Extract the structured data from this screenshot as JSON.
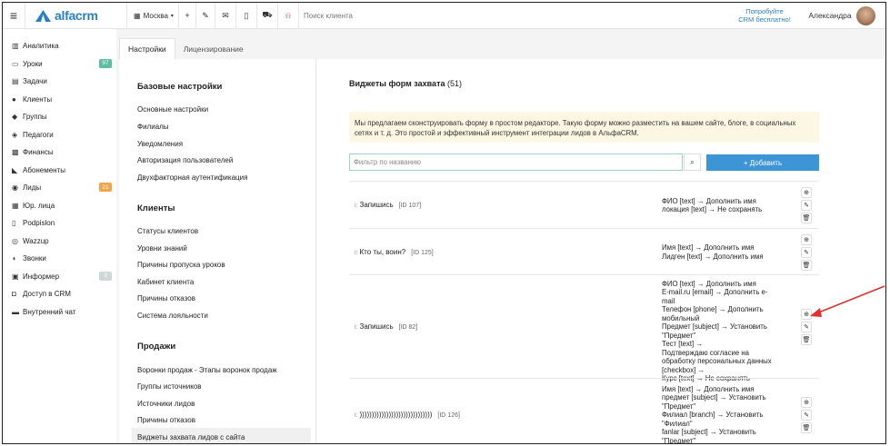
{
  "app": {
    "logo_text": "alfacrm",
    "brand_color": "#2a7fc4"
  },
  "topbar": {
    "city": "Москва",
    "search_placeholder": "Поиск клиента",
    "promo_line1": "Попробуйте",
    "promo_line2": "CRM бесплатно!",
    "user_name": "Александра"
  },
  "sidebar": {
    "items": [
      {
        "label": "Аналитика",
        "icon": "analytics-icon"
      },
      {
        "label": "Уроки",
        "icon": "calendar-icon",
        "badge": "97",
        "badge_color": "#5bbf9f"
      },
      {
        "label": "Задачи",
        "icon": "tasks-icon"
      },
      {
        "label": "Клиенты",
        "icon": "client-icon"
      },
      {
        "label": "Группы",
        "icon": "groups-icon"
      },
      {
        "label": "Педагоги",
        "icon": "teacher-icon"
      },
      {
        "label": "Финансы",
        "icon": "finance-icon"
      },
      {
        "label": "Абонементы",
        "icon": "tag-icon"
      },
      {
        "label": "Лиды",
        "icon": "leads-icon",
        "badge": "21",
        "badge_color": "#f0a54a"
      },
      {
        "label": "Юр. лица",
        "icon": "legal-icon"
      },
      {
        "label": "Podpislon",
        "icon": "document-icon"
      },
      {
        "label": "Wazzup",
        "icon": "whatsapp-icon"
      },
      {
        "label": "Звонки",
        "icon": "phone-icon"
      },
      {
        "label": "Информер",
        "icon": "informer-icon",
        "badge": "3",
        "badge_color": "#cfd6d6"
      },
      {
        "label": "Доступ в CRM",
        "icon": "lock-icon"
      },
      {
        "label": "Внутренний чат",
        "icon": "chat-icon"
      }
    ]
  },
  "tabs": [
    {
      "label": "Настройки"
    },
    {
      "label": "Лицензирование"
    }
  ],
  "settings_menu": {
    "base_title": "Базовые настройки",
    "base_items": [
      "Основные настройки",
      "Филиалы",
      "Уведомления",
      "Авторизация пользователей",
      "Двухфакторная аутентификация"
    ],
    "clients_title": "Клиенты",
    "clients_items": [
      "Статусы клиентов",
      "Уровни знаний",
      "Причины пропуска уроков",
      "Кабинет клиента",
      "Причины отказов",
      "Система лояльности"
    ],
    "sales_title": "Продажи",
    "sales_items": [
      "Воронки продаж - Этапы воронок продаж",
      "Группы источников",
      "Источники лидов",
      "Причины отказов",
      "Виджеты захвата лидов с сайта"
    ]
  },
  "main": {
    "title": "Виджеты форм захвата",
    "count": "(51)",
    "notice": "Мы предлагаем сконструировать форму в простом редакторе. Такую форму можно разместить на вашем сайте, блоге, в социальных сетях и т. д. Это простой и эффективный инструмент интеграции лидов в АльфаCRM.",
    "filter_placeholder": "Фильтр по названию",
    "add_label": "+ Добавить"
  },
  "widgets": [
    {
      "type": "i:",
      "name": "Запишись",
      "id": "[ID 107]",
      "fields": [
        "ФИО [text] → Дополнить имя",
        "локация [text] → Не сохранять"
      ]
    },
    {
      "type": "i:",
      "name": "Кто ты, воин?",
      "id": "[ID 125]",
      "fields": [
        "Имя [text] → Дополнить имя",
        "Лидген [text] → Дополнить имя"
      ]
    },
    {
      "type": "i:",
      "name": "Запишись",
      "id": "[ID 82]",
      "fields": [
        "ФИО [text] → Дополнить имя",
        "E-mail.ru [email] → Дополнить e-mail",
        "Телефон [phone] → Дополнить",
        "мобильный",
        "Предмет [subject] → Установить",
        "\"Предмет\"",
        "Тест [text] →",
        "Подтверждаю согласие на",
        "обработку персональных данных",
        "[checkbox] →",
        "Курс [text] → Не сохранять"
      ]
    },
    {
      "type": "i:",
      "name": "))))))))))))))))))))))))))))))",
      "id": "[ID 126]",
      "fields": [
        "Имя [text] → Дополнить имя",
        "предмет [subject] → Установить",
        "\"Предмет\"",
        "Филиал [branch] → Установить",
        "\"Филиал\"",
        "fanlar [subject] → Установить",
        "\"Предмет\""
      ]
    }
  ]
}
